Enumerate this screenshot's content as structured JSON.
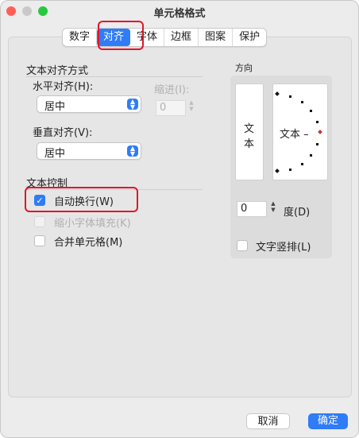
{
  "window": {
    "title": "单元格格式"
  },
  "tabs": [
    {
      "label": "数字"
    },
    {
      "label": "对齐",
      "active": true
    },
    {
      "label": "字体"
    },
    {
      "label": "边框"
    },
    {
      "label": "图案"
    },
    {
      "label": "保护"
    }
  ],
  "alignment": {
    "section_title": "文本对齐方式",
    "horizontal_label": "水平对齐(H):",
    "horizontal_value": "居中",
    "indent_label": "缩进(I):",
    "indent_value": "0",
    "vertical_label": "垂直对齐(V):",
    "vertical_value": "居中"
  },
  "text_control": {
    "section_title": "文本控制",
    "wrap_text": {
      "label": "自动换行(W)",
      "checked": true
    },
    "shrink_to_fit": {
      "label": "缩小字体填充(K)",
      "checked": false,
      "disabled": true
    },
    "merge_cells": {
      "label": "合并单元格(M)",
      "checked": false
    }
  },
  "orientation": {
    "section_title": "方向",
    "vertical_text_chars": [
      "文",
      "本"
    ],
    "dial_text": "文本 –",
    "degree_value": "0",
    "degree_label": "度(D)",
    "vertical_stack_label": "文字竖排(L)"
  },
  "footer": {
    "cancel_label": "取消",
    "ok_label": "确定"
  },
  "colors": {
    "accent": "#2f7cf6",
    "highlight_box": "#e3152b"
  },
  "icons": {
    "close": "close-icon",
    "minimize": "minimize-icon",
    "zoom": "zoom-icon",
    "dropdown": "chevron-updown-icon",
    "stepper": "stepper-icon",
    "check": "checkmark-icon"
  }
}
